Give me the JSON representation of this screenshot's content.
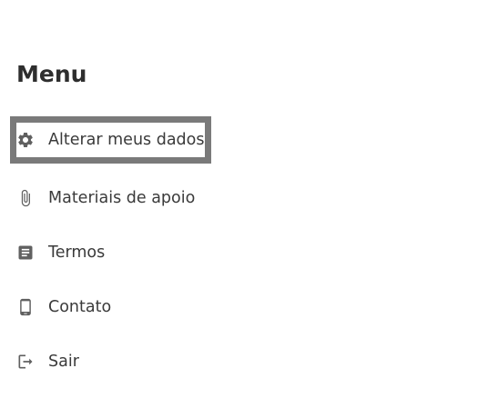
{
  "menu": {
    "title": "Menu",
    "items": [
      {
        "label": "Alterar meus dados",
        "icon": "gear-icon",
        "focused": true
      },
      {
        "label": "Materiais de apoio",
        "icon": "paperclip-icon",
        "focused": false
      },
      {
        "label": "Termos",
        "icon": "document-icon",
        "focused": false
      },
      {
        "label": "Contato",
        "icon": "mobile-phone-icon",
        "focused": false
      },
      {
        "label": "Sair",
        "icon": "logout-icon",
        "focused": false
      }
    ]
  },
  "colors": {
    "focus_border": "#7a7a7a",
    "icon": "#606060",
    "text": "#3a3a3a"
  }
}
